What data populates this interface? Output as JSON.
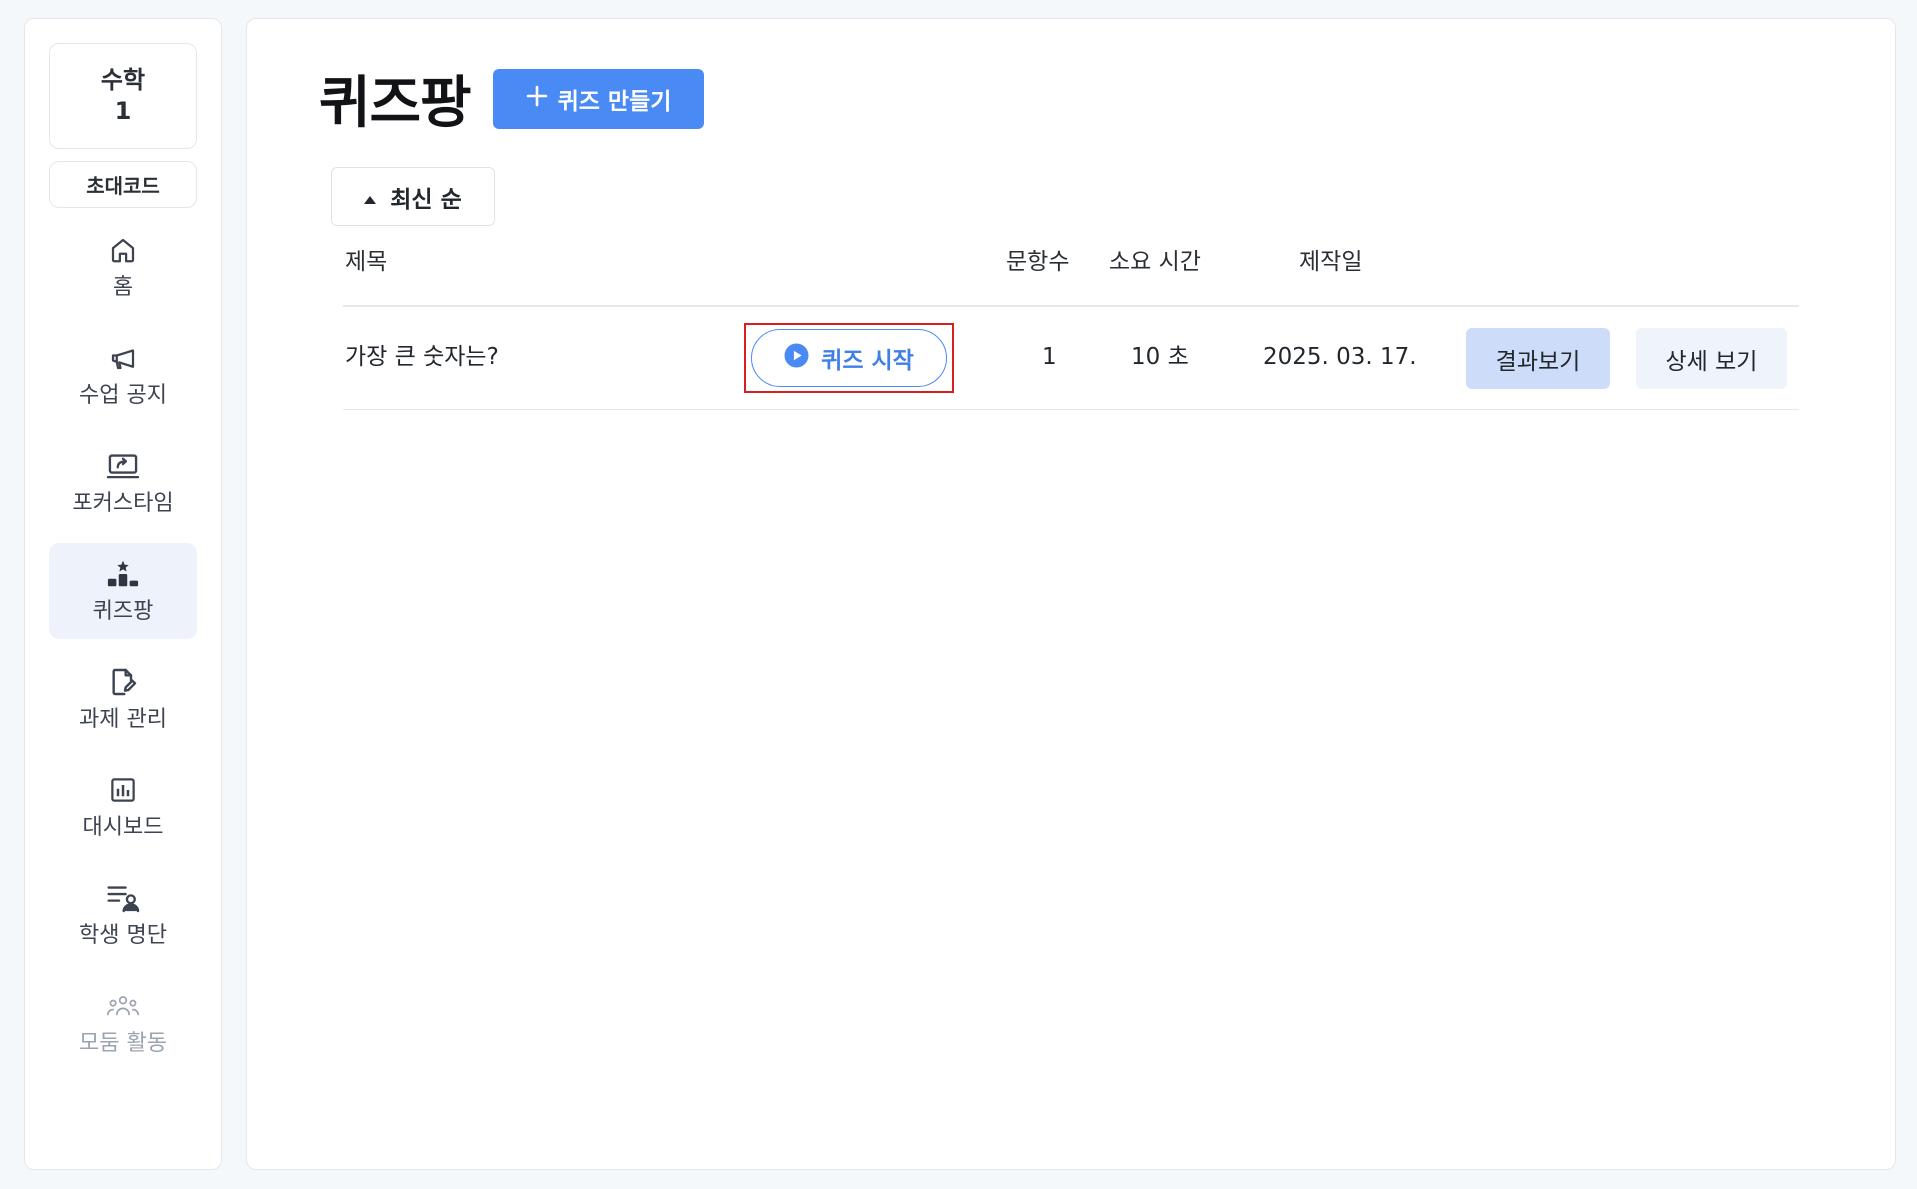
{
  "sidebar": {
    "class_card": {
      "line1": "수학",
      "line2": "1"
    },
    "invite_label": "초대코드",
    "items": [
      {
        "key": "home",
        "label": "홈",
        "icon": "home-icon"
      },
      {
        "key": "notice",
        "label": "수업 공지",
        "icon": "megaphone-icon"
      },
      {
        "key": "focus",
        "label": "포커스타임",
        "icon": "screen-share-icon"
      },
      {
        "key": "quiz",
        "label": "퀴즈팡",
        "icon": "podium-icon",
        "active": true
      },
      {
        "key": "assignment",
        "label": "과제 관리",
        "icon": "file-edit-icon"
      },
      {
        "key": "dashboard",
        "label": "대시보드",
        "icon": "bar-chart-icon"
      },
      {
        "key": "roster",
        "label": "학생 명단",
        "icon": "user-list-icon"
      },
      {
        "key": "group",
        "label": "모둠 활동",
        "icon": "group-icon",
        "disabled": true
      }
    ]
  },
  "main": {
    "title": "퀴즈팡",
    "create_label": "퀴즈 만들기",
    "sort_label": "최신 순",
    "columns": {
      "title": "제목",
      "count": "문항수",
      "duration": "소요 시간",
      "created": "제작일"
    },
    "rows": [
      {
        "title": "가장 큰 숫자는?",
        "start_label": "퀴즈 시작",
        "count": "1",
        "duration": "10 초",
        "created": "2025. 03. 17.",
        "result_label": "결과보기",
        "detail_label": "상세 보기"
      }
    ]
  },
  "colors": {
    "accent": "#4a8af4",
    "highlight_frame": "#d61f1f",
    "result_button_bg": "#cddcf8",
    "active_nav_bg": "#eef2fa"
  }
}
